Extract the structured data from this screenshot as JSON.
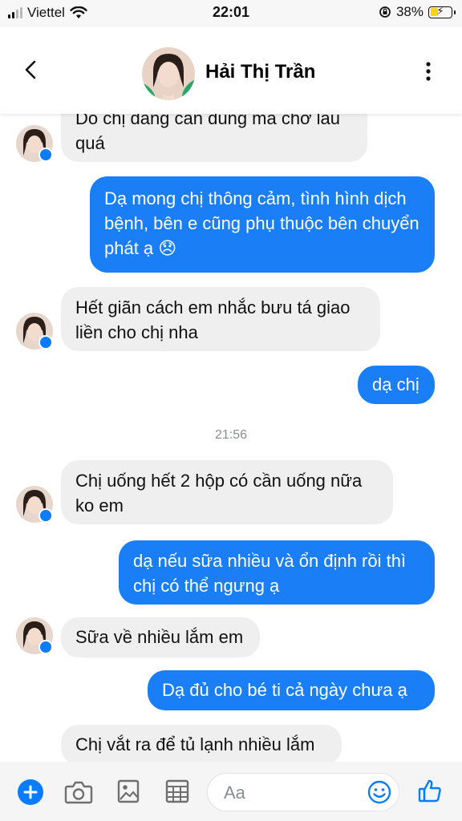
{
  "status_bar": {
    "carrier": "Viettel",
    "time": "22:01",
    "battery": "38%",
    "battery_level": 0.38
  },
  "header": {
    "contact_name": "Hải Thị Trần",
    "icons": [
      "back-arrow-icon",
      "more-vertical-icon"
    ]
  },
  "messages": [
    {
      "side": "in",
      "text": "Do chị đang cần dùng mà chờ lâu quá"
    },
    {
      "side": "out",
      "text": "Dạ mong chị thông cảm, tình hình dịch bệnh, bên e cũng phụ thuộc bên chuyển phát ạ 😞"
    },
    {
      "side": "in",
      "text": "Hết giãn cách em nhắc bưu tá giao liền cho chị nha"
    },
    {
      "side": "out",
      "text": "dạ chị"
    },
    {
      "side": "timestamp",
      "text": "21:56"
    },
    {
      "side": "in",
      "text": "Chị uống hết 2 hộp có cần uống nữa ko em"
    },
    {
      "side": "out",
      "text": "dạ nếu sữa nhiều và ổn định rồi thì chị có thể ngưng ạ"
    },
    {
      "side": "in",
      "text": "Sữa về nhiều lắm em"
    },
    {
      "side": "out",
      "text": "Dạ đủ cho bé ti cả ngày chưa ạ"
    },
    {
      "side": "in",
      "text": "Chị vắt ra để tủ lạnh nhiều lắm"
    }
  ],
  "composer": {
    "placeholder": "Aa",
    "icons": [
      "plus-icon",
      "camera-icon",
      "gallery-icon",
      "sticker-grid-icon",
      "emoji-icon",
      "thumbs-up-icon"
    ]
  },
  "colors": {
    "outgoing_bubble": "#1a7ef7",
    "incoming_bubble": "#efefef",
    "messenger_blue": "#0a7cff",
    "battery_fill": "#f5d316"
  }
}
